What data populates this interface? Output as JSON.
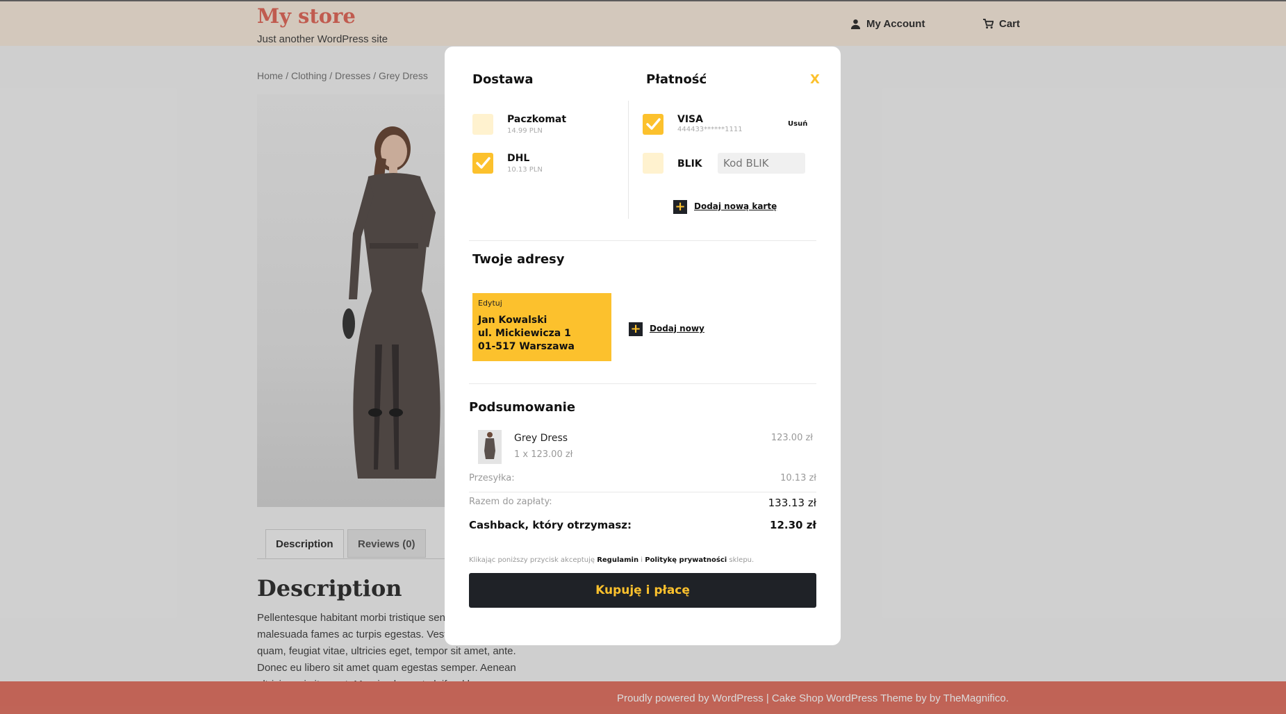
{
  "header": {
    "site_title": "My store",
    "site_description": "Just another WordPress site",
    "nav": {
      "account_label": "My Account",
      "cart_label": "Cart"
    }
  },
  "breadcrumb": "Home / Clothing / Dresses / Grey Dress",
  "tabs": {
    "description_label": "Description",
    "reviews_label": "Reviews (0)"
  },
  "description": {
    "title": "Description",
    "text": "Pellentesque habitant morbi tristique senectus et netus et malesuada fames ac turpis egestas. Vestibulum tortor quam, feugiat vitae, ultricies eget, tempor sit amet, ante. Donec eu libero sit amet quam egestas semper. Aenean ultricies mi vitae est. Mauris placerat eleifend leo."
  },
  "footer": {
    "text": "Proudly powered by WordPress |  Cake Shop WordPress Theme by by TheMagnifico."
  },
  "modal": {
    "close_label": "X",
    "delivery": {
      "title": "Dostawa",
      "options": [
        {
          "name": "Paczkomat",
          "price": "14.99 PLN",
          "checked": false
        },
        {
          "name": "DHL",
          "price": "10.13 PLN",
          "checked": true
        }
      ]
    },
    "payment": {
      "title": "Płatność",
      "card": {
        "name": "VISA",
        "number": "444433******1111",
        "remove_label": "Usuń",
        "checked": true
      },
      "blik": {
        "name": "BLIK",
        "placeholder": "Kod BLIK",
        "checked": false
      },
      "add_card_label": "Dodaj nową kartę"
    },
    "addresses": {
      "title": "Twoje adresy",
      "card": {
        "edit_label": "Edytuj",
        "name": "Jan Kowalski",
        "street": "ul. Mickiewicza 1",
        "city": "01-517 Warszawa"
      },
      "add_label": "Dodaj nowy"
    },
    "summary": {
      "title": "Podsumowanie",
      "item": {
        "name": "Grey Dress",
        "qty_price": "1 x 123.00 zł",
        "total": "123.00 zł"
      },
      "shipping_label": "Przesyłka:",
      "shipping_value": "10.13 zł",
      "total_label": "Razem do zapłaty:",
      "total_value": "133.13 zł",
      "cashback_label": "Cashback, który otrzymasz:",
      "cashback_value": "12.30 zł"
    },
    "terms": {
      "prefix": "Klikając poniższy przycisk akceptuję",
      "regulamin": "Regulamin",
      "sep": "i",
      "policy": "Politykę prywatności",
      "suffix": "sklepu."
    },
    "buy_label": "Kupuję i płacę"
  },
  "colors": {
    "accent": "#fcc12d",
    "dark": "#1f2227",
    "brand": "#e06a5c",
    "footer": "#e07465"
  }
}
